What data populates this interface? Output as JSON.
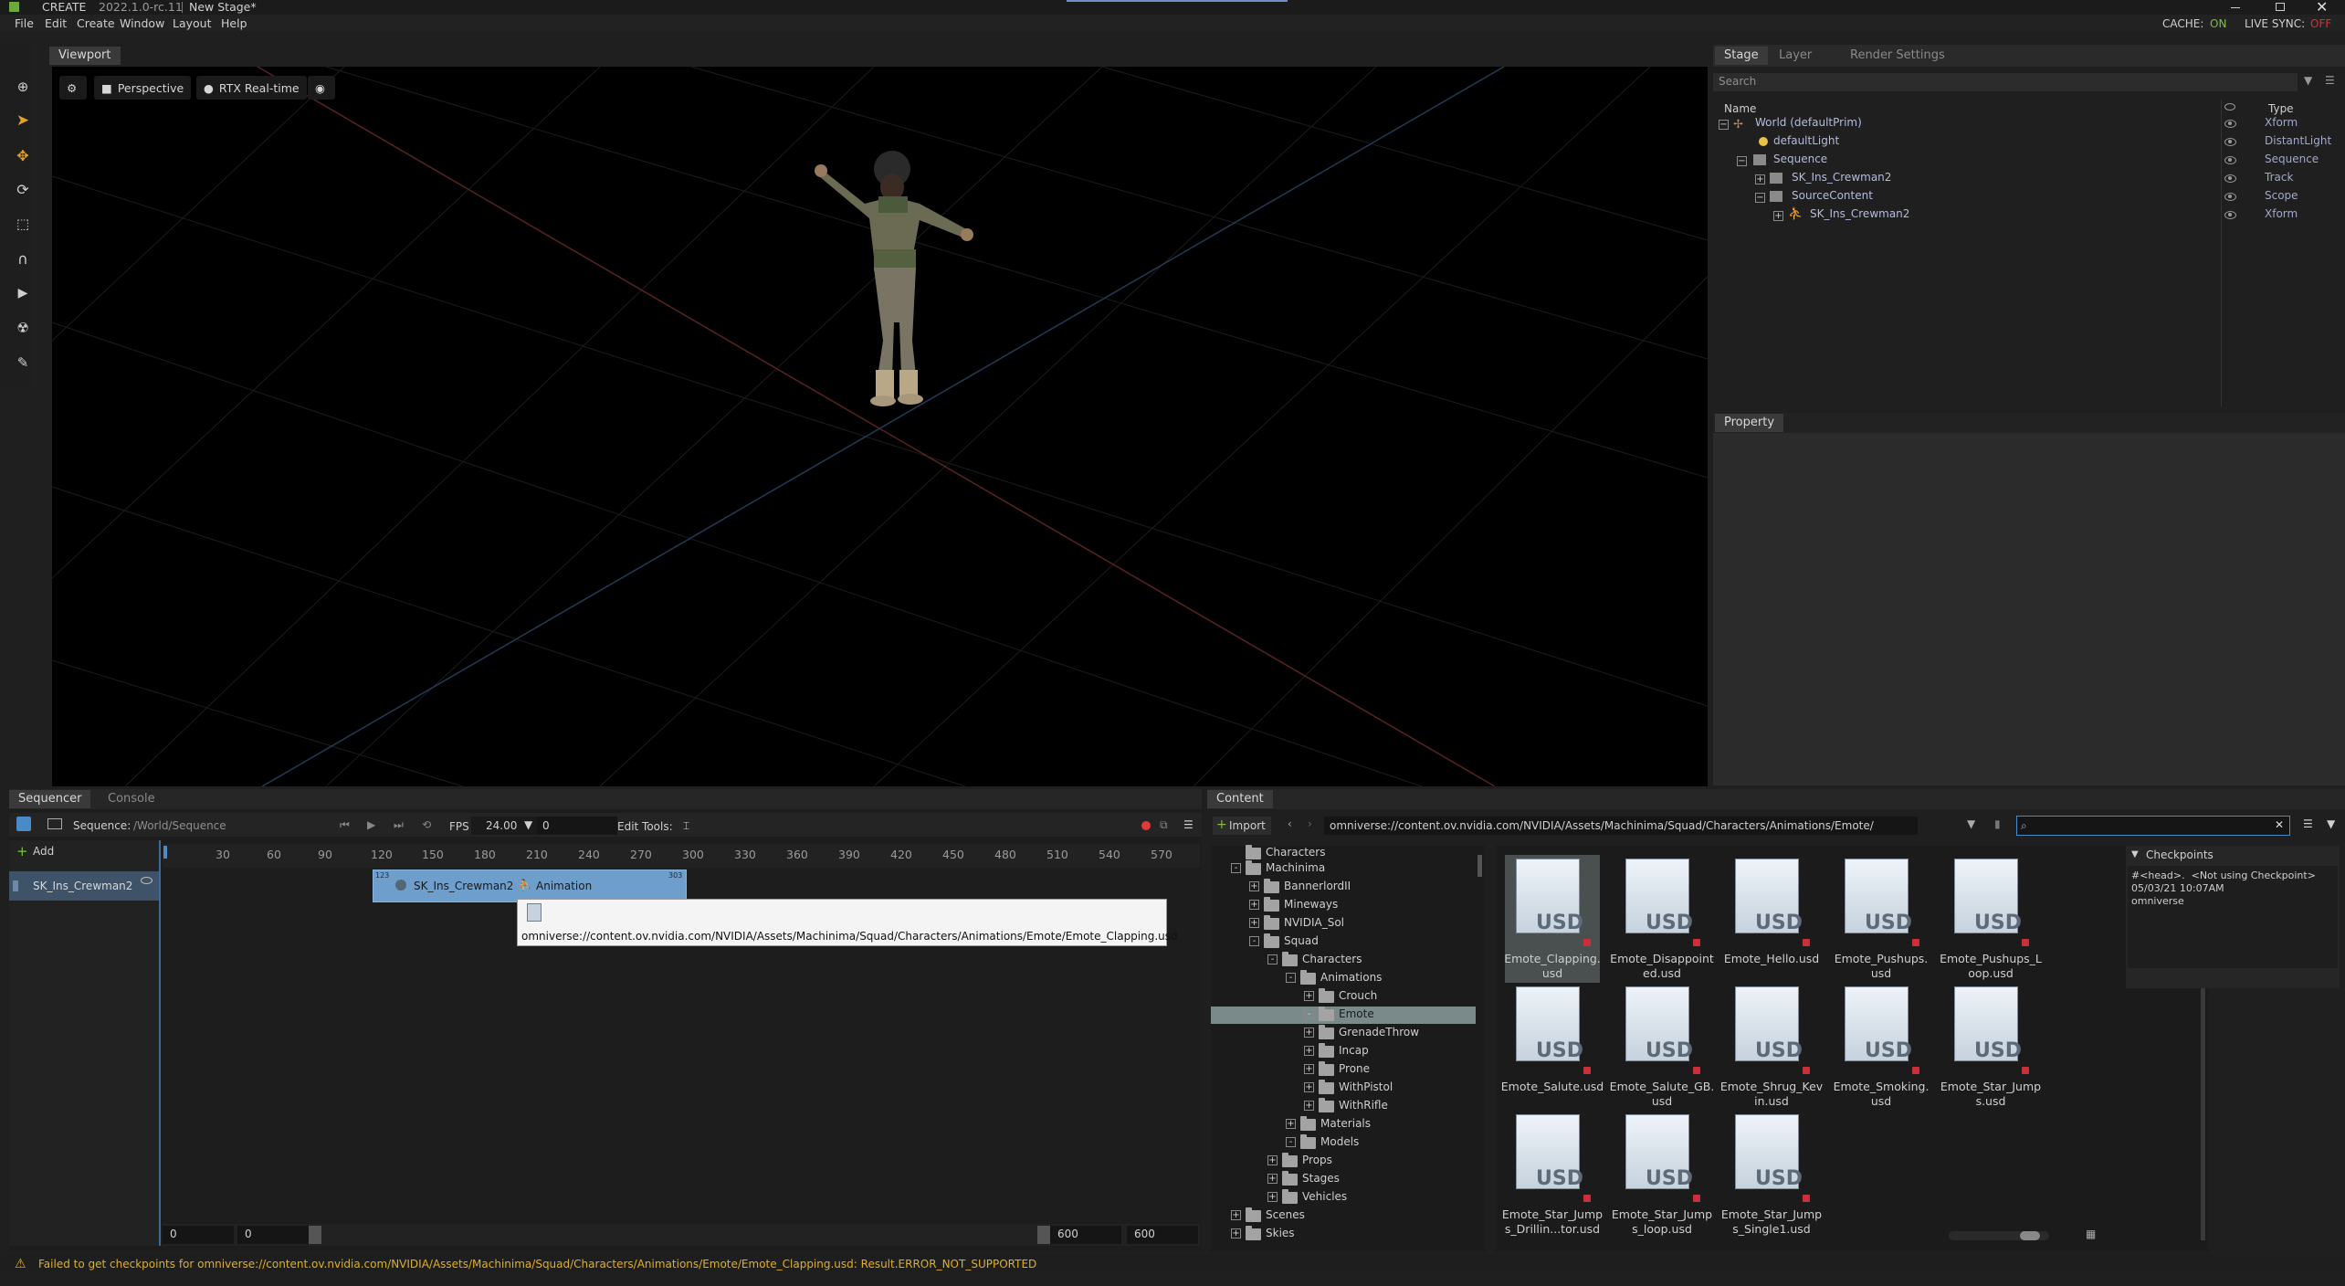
{
  "titlebar": {
    "app": "CREATE",
    "version": "2022.1.0-rc.11",
    "stage": "New Stage*"
  },
  "menu": {
    "items": [
      "File",
      "Edit",
      "Create",
      "Window",
      "Layout",
      "Help"
    ],
    "cache_label": "CACHE:",
    "cache_value": "ON",
    "livesync_label": "LIVE SYNC:",
    "livesync_value": "OFF"
  },
  "viewport": {
    "tab": "Viewport",
    "camera": "Perspective",
    "renderer": "RTX Real-time"
  },
  "stage": {
    "tabs": [
      "Stage",
      "Layer",
      "Render Settings"
    ],
    "search_placeholder": "Search",
    "col_name": "Name",
    "col_type": "Type",
    "rows": [
      {
        "name": "World (defaultPrim)",
        "type": "Xform"
      },
      {
        "name": "defaultLight",
        "type": "DistantLight"
      },
      {
        "name": "Sequence",
        "type": "Sequence"
      },
      {
        "name": "SK_Ins_Crewman2",
        "type": "Track"
      },
      {
        "name": "SourceContent",
        "type": "Scope"
      },
      {
        "name": "SK_Ins_Crewman2",
        "type": "Xform"
      }
    ]
  },
  "property": {
    "tab": "Property"
  },
  "sequencer": {
    "tabs": [
      "Sequencer",
      "Console"
    ],
    "sequence_label": "Sequence:",
    "sequence_path": "/World/Sequence",
    "fps_label": "FPS",
    "fps_value": "24.00",
    "frame_value": "0",
    "edit_tools": "Edit Tools:",
    "add_label": "Add",
    "track_name": "SK_Ins_Crewman2",
    "ruler": [
      "30",
      "60",
      "90",
      "120",
      "150",
      "180",
      "210",
      "240",
      "270",
      "300",
      "330",
      "360",
      "390",
      "420",
      "450",
      "480",
      "510",
      "540",
      "570"
    ],
    "clip_start": "123",
    "clip_end": "303",
    "clip_name": "SK_Ins_Crewman2",
    "anim_label": "Animation",
    "tooltip": "omniverse://content.ov.nvidia.com/NVIDIA/Assets/Machinima/Squad/Characters/Animations/Emote/Emote_Clapping.usd",
    "range_start_a": "0",
    "range_start_b": "0",
    "range_end_a": "600",
    "range_end_b": "600"
  },
  "content": {
    "tab": "Content",
    "import_label": "Import",
    "path": "omniverse://content.ov.nvidia.com/NVIDIA/Assets/Machinima/Squad/Characters/Animations/Emote/",
    "search_value": "",
    "tree": [
      {
        "label": "Characters",
        "exp": ""
      },
      {
        "label": "Machinima",
        "exp": "-"
      },
      {
        "label": "BannerlordII",
        "exp": "+"
      },
      {
        "label": "Mineways",
        "exp": "+"
      },
      {
        "label": "NVIDIA_Sol",
        "exp": "+"
      },
      {
        "label": "Squad",
        "exp": "-"
      },
      {
        "label": "Characters",
        "exp": "-"
      },
      {
        "label": "Animations",
        "exp": "-"
      },
      {
        "label": "Crouch",
        "exp": "+"
      },
      {
        "label": "Emote",
        "exp": "-"
      },
      {
        "label": "GrenadeThrow",
        "exp": "+"
      },
      {
        "label": "Incap",
        "exp": "+"
      },
      {
        "label": "Prone",
        "exp": "+"
      },
      {
        "label": "WithPistol",
        "exp": "+"
      },
      {
        "label": "WithRifle",
        "exp": "+"
      },
      {
        "label": "Materials",
        "exp": "+"
      },
      {
        "label": "Models",
        "exp": "-"
      },
      {
        "label": "Props",
        "exp": "+"
      },
      {
        "label": "Stages",
        "exp": "+"
      },
      {
        "label": "Vehicles",
        "exp": "+"
      },
      {
        "label": "Scenes",
        "exp": "+"
      },
      {
        "label": "Skies",
        "exp": "+"
      }
    ],
    "files": [
      {
        "l1": "Emote_Clapping.",
        "l2": "usd"
      },
      {
        "l1": "Emote_Disappoint",
        "l2": "ed.usd"
      },
      {
        "l1": "Emote_Hello.usd",
        "l2": ""
      },
      {
        "l1": "Emote_Pushups.",
        "l2": "usd"
      },
      {
        "l1": "Emote_Pushups_L",
        "l2": "oop.usd"
      },
      {
        "l1": "Emote_Salute.usd",
        "l2": ""
      },
      {
        "l1": "Emote_Salute_GB.",
        "l2": "usd"
      },
      {
        "l1": "Emote_Shrug_Kev",
        "l2": "in.usd"
      },
      {
        "l1": "Emote_Smoking.",
        "l2": "usd"
      },
      {
        "l1": "Emote_Star_Jump",
        "l2": "s.usd"
      },
      {
        "l1": "Emote_Star_Jump",
        "l2": "s_Drillin...tor.usd"
      },
      {
        "l1": "Emote_Star_Jump",
        "l2": "s_loop.usd"
      },
      {
        "l1": "Emote_Star_Jump",
        "l2": "s_Single1.usd"
      }
    ],
    "file_icon_text": "USD",
    "checkpoints": {
      "title": "Checkpoints",
      "line1": "#<head>.  <Not using Checkpoint>",
      "line2": "05/03/21 10:07AM",
      "line3": "omniverse"
    }
  },
  "status": {
    "message": "Failed to get checkpoints for omniverse://content.ov.nvidia.com/NVIDIA/Assets/Machinima/Squad/Characters/Animations/Emote/Emote_Clapping.usd: Result.ERROR_NOT_SUPPORTED"
  },
  "colors": {
    "accent": "#7fbf3f",
    "off": "#d33333",
    "selection": "#7a8a8a",
    "clip": "#6e9ecb",
    "warning": "#e0b020"
  }
}
